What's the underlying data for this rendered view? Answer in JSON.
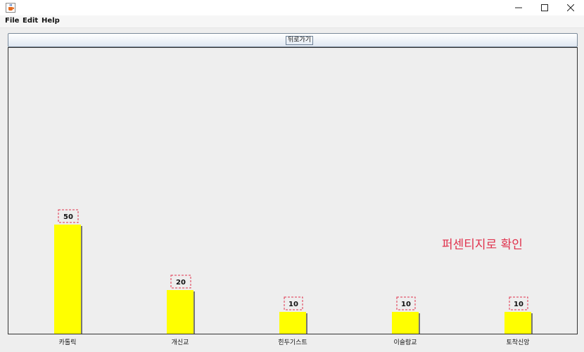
{
  "window": {
    "app_icon": "java-cup-icon",
    "controls": [
      "minimize-icon",
      "maximize-icon",
      "close-icon"
    ]
  },
  "menubar": {
    "items": [
      "File",
      "Edit",
      "Help"
    ]
  },
  "main": {
    "back_button": "뒤로가기",
    "caption": "퍼센티지로 확인"
  },
  "colors": {
    "bar": "#ffff00",
    "bar_shadow": "#777777",
    "label_box": "#e0314c",
    "caption": "#e0314c",
    "panel_bg": "#eeeeee"
  },
  "chart_data": {
    "type": "bar",
    "categories": [
      "카톨릭",
      "개신교",
      "힌두기스트",
      "이슬람교",
      "토착신앙"
    ],
    "values": [
      50,
      20,
      10,
      10,
      10
    ],
    "title": "",
    "xlabel": "",
    "ylabel": "",
    "ylim": [
      0,
      100
    ],
    "grid": false,
    "legend": "none"
  }
}
